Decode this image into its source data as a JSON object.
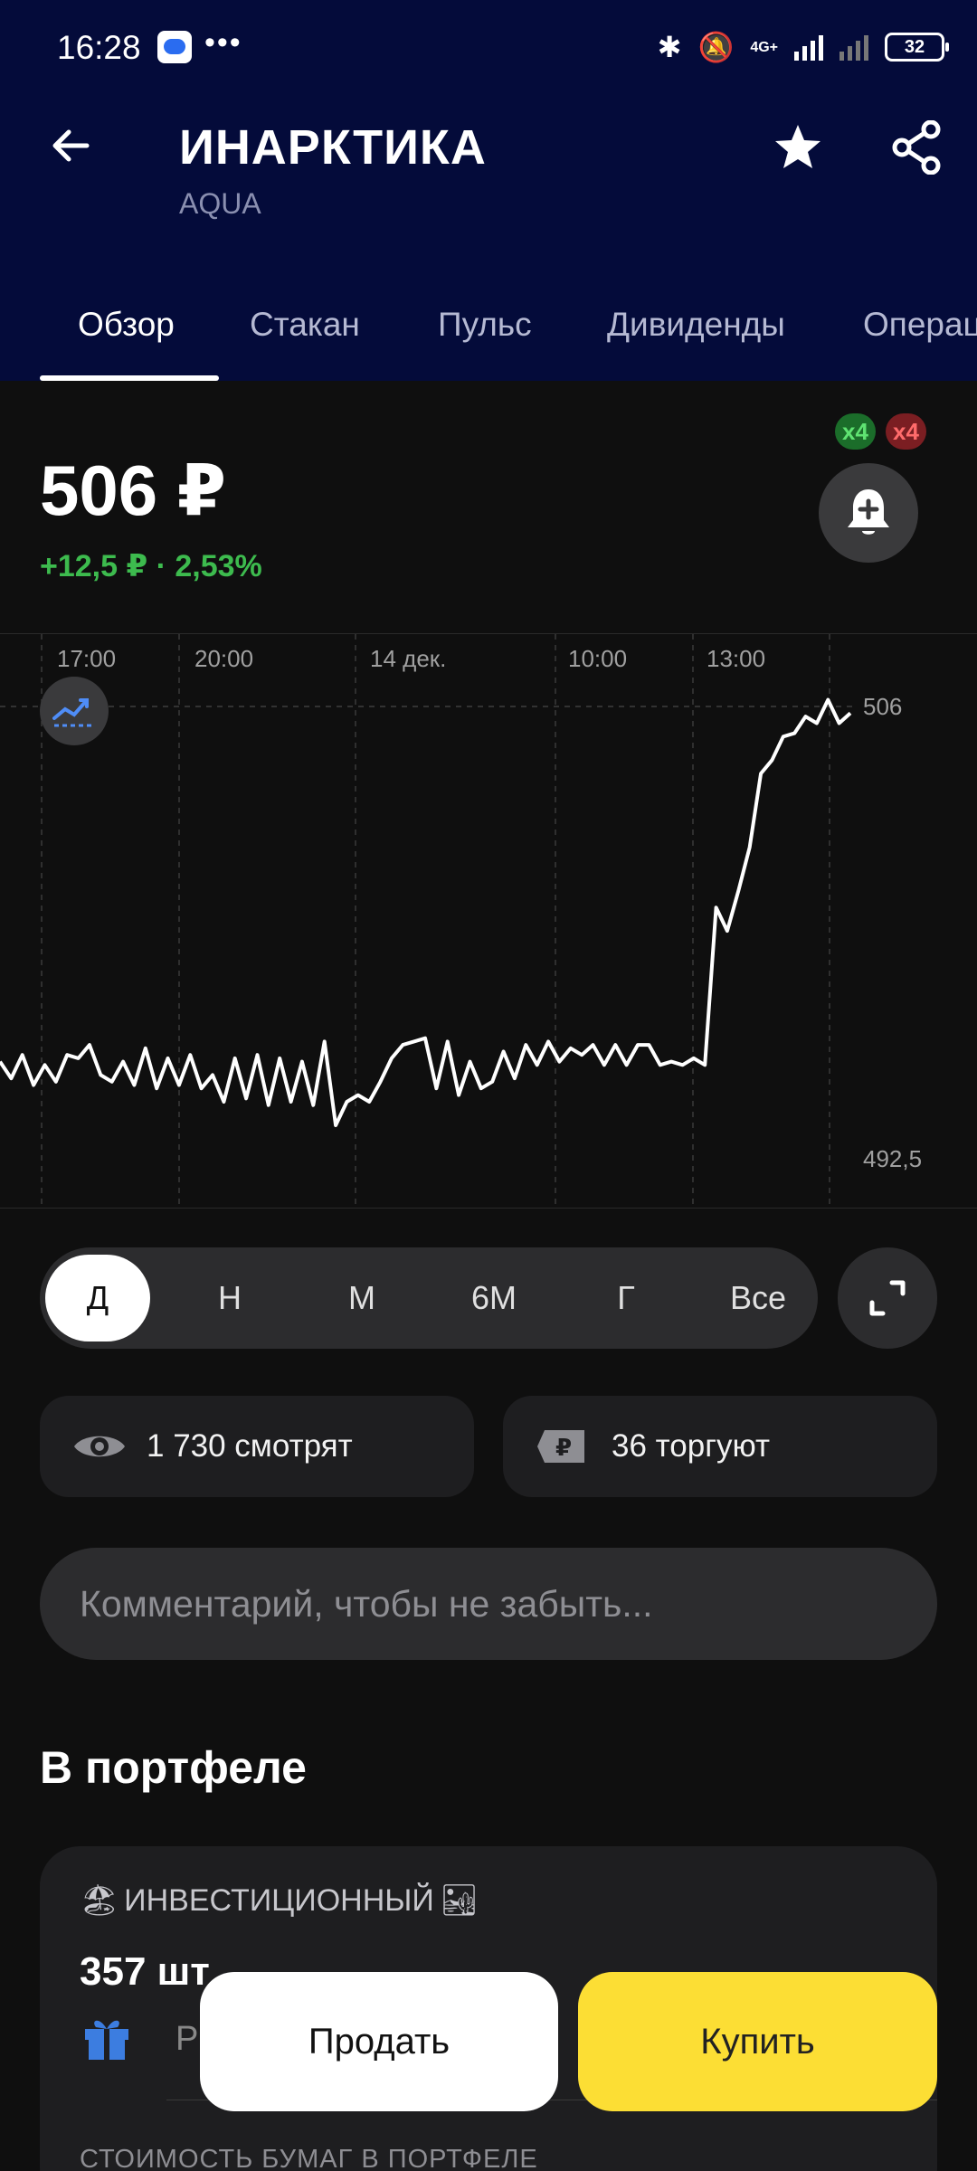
{
  "status_bar": {
    "time": "16:28",
    "dots": "•••",
    "network": "4G+",
    "battery": "32"
  },
  "header": {
    "title": "ИНАРКТИКА",
    "ticker": "AQUA"
  },
  "tabs": [
    {
      "label": "Обзор",
      "active": true
    },
    {
      "label": "Стакан"
    },
    {
      "label": "Пульс"
    },
    {
      "label": "Дивиденды"
    },
    {
      "label": "Операц"
    }
  ],
  "quote": {
    "price": "506 ₽",
    "change": "+12,5 ₽ · 2,53%",
    "badge_green": "x4",
    "badge_red": "x4"
  },
  "chart_data": {
    "type": "line",
    "x_ticks": [
      "17:00",
      "20:00",
      "14 дек.",
      "10:00",
      "13:00"
    ],
    "y_labels": [
      "506",
      "492,5"
    ],
    "ylim": [
      491,
      507.5
    ],
    "grid": "vertical",
    "series": [
      {
        "values": [
          495.4,
          494.9,
          495.6,
          494.7,
          495.3,
          494.8,
          495.6,
          495.5,
          495.9,
          495.0,
          494.8,
          495.4,
          494.7,
          495.8,
          494.6,
          495.5,
          494.7,
          495.6,
          494.6,
          495.0,
          494.2,
          495.5,
          494.3,
          495.6,
          494.1,
          495.5,
          494.2,
          495.4,
          494.1,
          496.0,
          493.5,
          494.2,
          494.4,
          494.2,
          494.8,
          495.5,
          495.9,
          496.0,
          496.1,
          494.6,
          496.0,
          494.4,
          495.4,
          494.6,
          494.8,
          495.7,
          494.9,
          495.9,
          495.3,
          496.0,
          495.4,
          495.8,
          495.6,
          495.9,
          495.3,
          495.9,
          495.3,
          495.9,
          495.9,
          495.3,
          495.4,
          495.3,
          495.5,
          495.3,
          500.0,
          499.3,
          500.5,
          501.8,
          504.0,
          504.4,
          505.1,
          505.2,
          505.7,
          505.5,
          506.2,
          505.5,
          505.8
        ]
      }
    ]
  },
  "periods": [
    {
      "label": "Д",
      "active": true
    },
    {
      "label": "Н"
    },
    {
      "label": "М"
    },
    {
      "label": "6М"
    },
    {
      "label": "Г"
    },
    {
      "label": "Все"
    }
  ],
  "stats": {
    "watching": "1 730 смотрят",
    "trading": "36 торгуют"
  },
  "comment": {
    "placeholder": "Комментарий, чтобы не забыть..."
  },
  "portfolio": {
    "section_title": "В портфеле",
    "name": "ИНВЕСТИЦИОННЫЙ",
    "emoji_left": "🏖",
    "emoji_right": "🏜",
    "qty": "357 шт",
    "r_label": "Р",
    "cost_label": "СТОИМОСТЬ БУМАГ В ПОРТФЕЛЕ"
  },
  "actions": {
    "sell": "Продать",
    "buy": "Купить"
  },
  "colors": {
    "header_bg": "#040b3a",
    "positive": "#3dbb4e",
    "buy": "#fcde34"
  },
  "icons": [
    "back-arrow-icon",
    "star-icon",
    "share-icon",
    "bell-plus-icon",
    "chart-mode-icon",
    "expand-icon",
    "eye-icon",
    "ruble-tag-icon",
    "gift-icon"
  ]
}
